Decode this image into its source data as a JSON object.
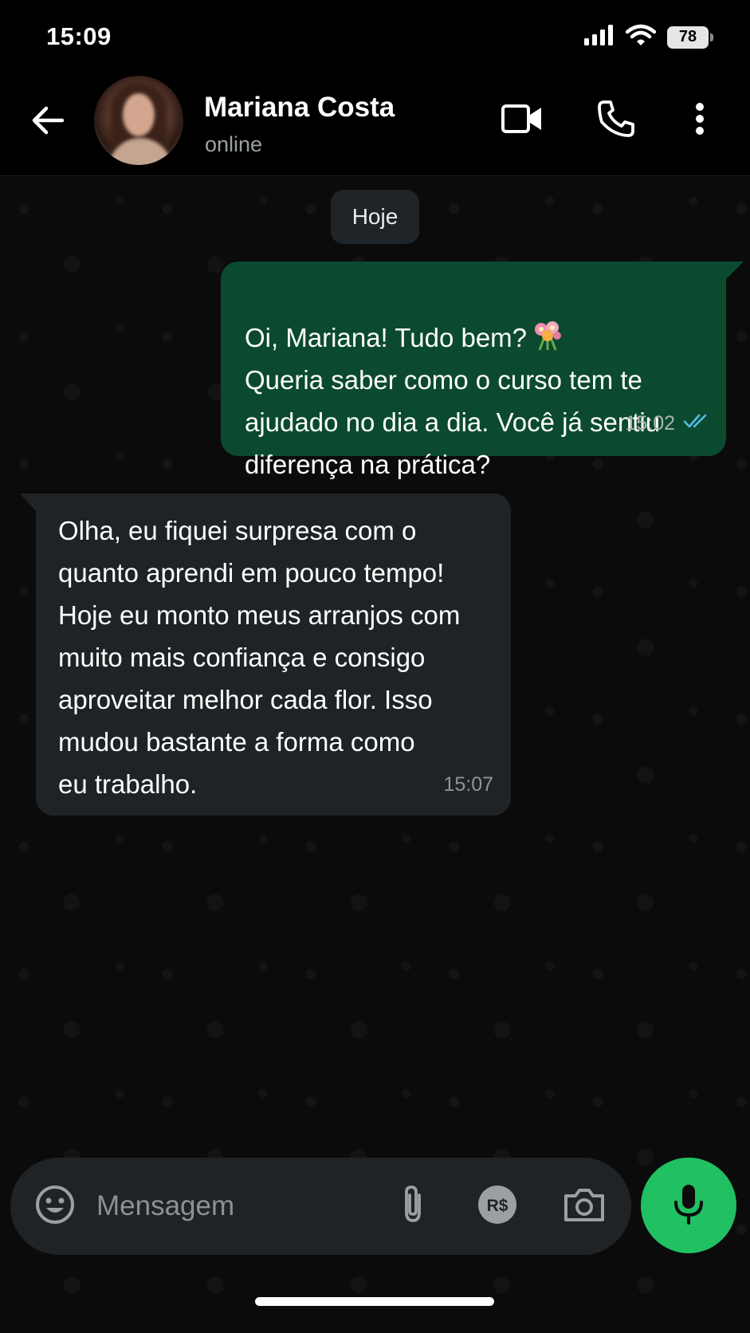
{
  "status_bar": {
    "time": "15:09",
    "battery": "78",
    "icons": [
      "signal-icon",
      "wifi-icon",
      "battery-icon"
    ]
  },
  "header": {
    "contact_name": "Mariana Costa",
    "contact_status": "online",
    "icons": [
      "back-arrow-icon",
      "video-call-icon",
      "phone-icon",
      "more-vertical-icon"
    ]
  },
  "chat": {
    "date_chip": "Hoje",
    "messages": [
      {
        "direction": "outgoing",
        "text": "Oi, Mariana! Tudo bem?\nQueria saber como o curso tem te\najudado no dia a dia. Você já sentiu\ndiferença na prática?",
        "emoji": "💐",
        "time": "15:02",
        "status": "read"
      },
      {
        "direction": "incoming",
        "text": "Olha, eu fiquei surpresa com o\nquanto aprendi em pouco tempo!\nHoje eu monto meus arranjos com\nmuito mais confiança e consigo\naproveitar melhor cada flor. Isso\nmudou bastante a forma como\neu trabalho.",
        "time": "15:07"
      }
    ]
  },
  "composer": {
    "placeholder": "Mensagem",
    "value": "",
    "pay_label": "R$",
    "icons": [
      "emoji-icon",
      "attach-icon",
      "pay-icon",
      "camera-icon",
      "microphone-icon"
    ]
  },
  "colors": {
    "outgoing_bubble": "#0b4a2f",
    "incoming_bubble": "#1f2326",
    "mic_button": "#21c063",
    "read_ticks": "#53bdeb",
    "background": "#0b0b0b"
  }
}
